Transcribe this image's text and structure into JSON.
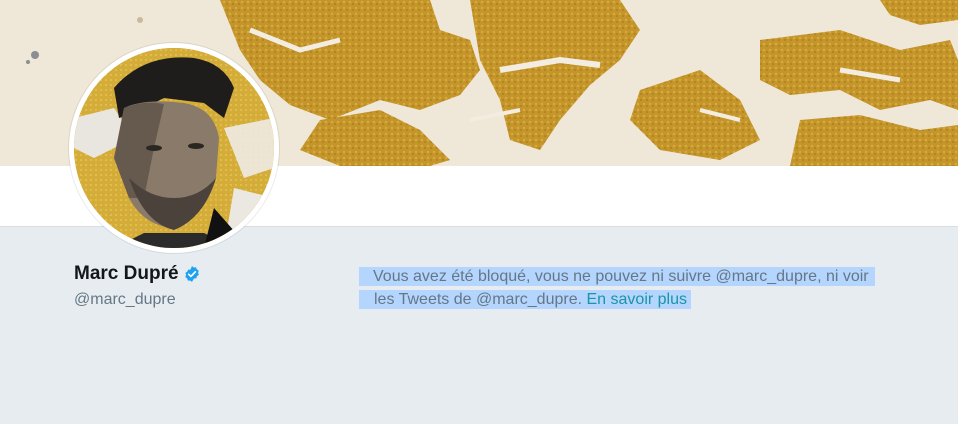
{
  "profile": {
    "name": "Marc Dupré",
    "handle": "@marc_dupre",
    "verified": true
  },
  "blocked_notice": {
    "line1": "Vous avez été bloqué, vous ne pouvez ni suivre @marc_dupre, ni voir",
    "line2_prefix": "les Tweets de @marc_dupre. ",
    "learn_more": "En savoir plus"
  },
  "icons": {
    "verified": "verified-badge-icon"
  },
  "colors": {
    "page_background": "#e6ecf0",
    "link": "#1b95a6",
    "verified_blue": "#1da1f2",
    "selection": "#b4d5fe",
    "muted_text": "#657786",
    "name_text": "#14171a"
  }
}
